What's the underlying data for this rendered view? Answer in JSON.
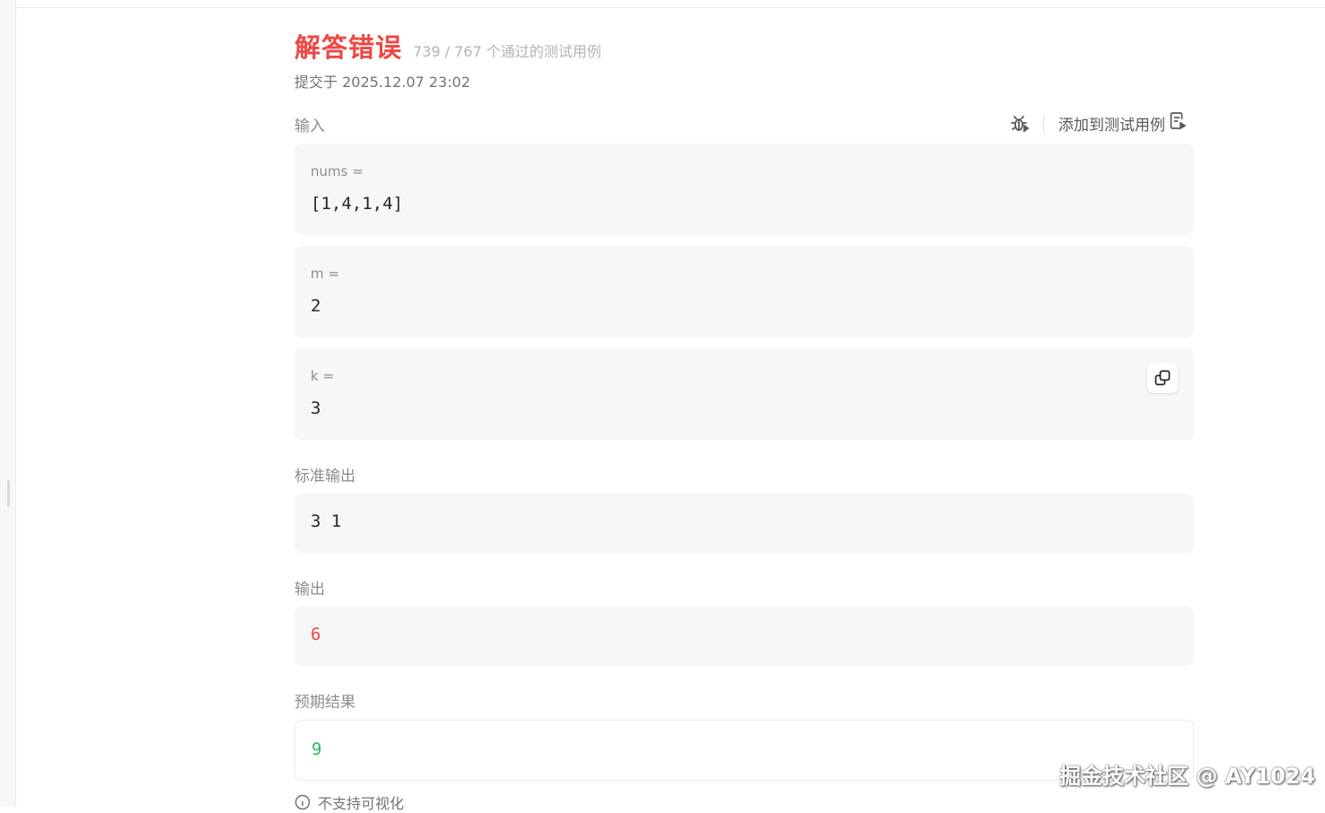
{
  "result": {
    "verdict": "解答错误",
    "passed_summary": "739 / 767 个通过的测试用例",
    "submitted_at": "提交于 2025.12.07 23:02"
  },
  "input_section": {
    "label": "输入",
    "add_test_label": "添加到测试用例",
    "params": [
      {
        "name": "nums =",
        "value": "[1,4,1,4]"
      },
      {
        "name": "m =",
        "value": "2"
      },
      {
        "name": "k =",
        "value": "3"
      }
    ]
  },
  "stdout_section": {
    "label": "标准输出",
    "value": "3 1"
  },
  "output_section": {
    "label": "输出",
    "value": "6"
  },
  "expected_section": {
    "label": "预期结果",
    "value": "9"
  },
  "visualization_note": "不支持可视化",
  "watermark": "掘金技术社区 @ AY1024",
  "colors": {
    "verdict": "#ef4743",
    "output_value": "#ef4743",
    "expected_value": "#2db55d"
  }
}
